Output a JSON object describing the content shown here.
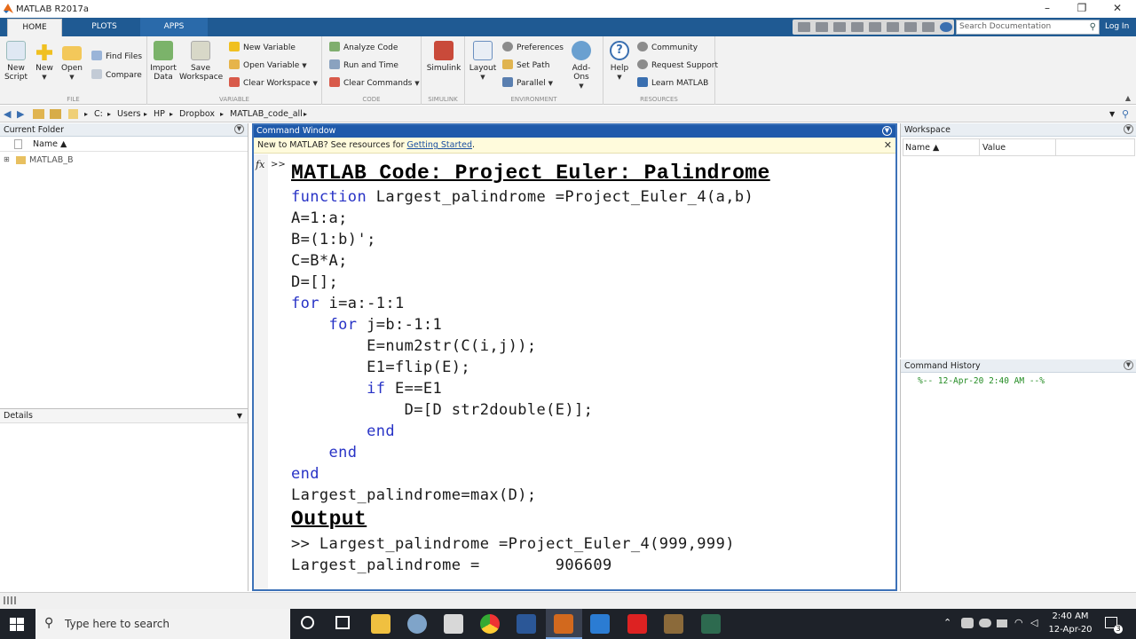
{
  "window": {
    "title": "MATLAB R2017a",
    "min": "–",
    "max": "❐",
    "close": "✕"
  },
  "tabs": [
    "HOME",
    "PLOTS",
    "APPS"
  ],
  "search": {
    "placeholder": "Search Documentation"
  },
  "login": "Log In",
  "ribbon": {
    "file": {
      "label": "FILE",
      "new_script": "New\nScript",
      "new": "New",
      "open": "Open",
      "find_files": "Find Files",
      "compare": "Compare"
    },
    "variable": {
      "label": "VARIABLE",
      "import_data": "Import\nData",
      "save_workspace": "Save\nWorkspace",
      "new_variable": "New Variable",
      "open_variable": "Open Variable",
      "clear_workspace": "Clear Workspace"
    },
    "code": {
      "label": "CODE",
      "analyze_code": "Analyze Code",
      "run_and_time": "Run and Time",
      "clear_commands": "Clear Commands"
    },
    "simulink": {
      "label": "SIMULINK",
      "simulink": "Simulink"
    },
    "environment": {
      "label": "ENVIRONMENT",
      "layout": "Layout",
      "preferences": "Preferences",
      "set_path": "Set Path",
      "parallel": "Parallel",
      "addons": "Add-Ons"
    },
    "resources": {
      "label": "RESOURCES",
      "help": "Help",
      "community": "Community",
      "request_support": "Request Support",
      "learn_matlab": "Learn MATLAB"
    }
  },
  "address": [
    "C:",
    "Users",
    "HP",
    "Dropbox",
    "MATLAB_code_all"
  ],
  "current_folder": {
    "title": "Current Folder",
    "col_name": "Name ▲",
    "items": [
      "MATLAB_B"
    ]
  },
  "details": {
    "title": "Details"
  },
  "command_window": {
    "title": "Command Window",
    "notice": "New to MATLAB? See resources for ",
    "notice_link": "Getting Started",
    "notice_end": ".",
    "fx": "fx",
    "prompt": ">>",
    "heading": "MATLAB Code: Project Euler: Palindrome",
    "lines": [
      {
        "kw": "function",
        "rest": " Largest_palindrome =Project_Euler_4(a,b)"
      },
      {
        "kw": "",
        "rest": "A=1:a;"
      },
      {
        "kw": "",
        "rest": "B=(1:b)';"
      },
      {
        "kw": "",
        "rest": "C=B*A;"
      },
      {
        "kw": "",
        "rest": "D=[];"
      },
      {
        "kw": "for",
        "rest": " i=a:-1:1"
      },
      {
        "kw": "    for",
        "rest": " j=b:-1:1"
      },
      {
        "kw": "",
        "rest": "        E=num2str(C(i,j));"
      },
      {
        "kw": "",
        "rest": "        E1=flip(E);"
      },
      {
        "kw": "        if",
        "rest": " E==E1"
      },
      {
        "kw": "",
        "rest": "            D=[D str2double(E)];"
      },
      {
        "kw": "        end",
        "rest": ""
      },
      {
        "kw": "    end",
        "rest": ""
      },
      {
        "kw": "end",
        "rest": ""
      },
      {
        "kw": "",
        "rest": "Largest_palindrome=max(D);"
      }
    ],
    "output_heading": "Output",
    "out1": ">> Largest_palindrome =Project_Euler_4(999,999)",
    "out2": "Largest_palindrome =        906609"
  },
  "workspace": {
    "title": "Workspace",
    "col_name": "Name ▲",
    "col_value": "Value"
  },
  "history": {
    "title": "Command History",
    "entry": "%-- 12-Apr-20 2:40 AM --%"
  },
  "taskbar": {
    "search": "Type here to search",
    "time": "2:40 AM",
    "date": "12-Apr-20",
    "notif": "3"
  },
  "colors": {
    "accent": "#1f5a93",
    "cmd_header": "#1f5aab",
    "keyword": "#2833c6",
    "history_green": "#228b22"
  }
}
